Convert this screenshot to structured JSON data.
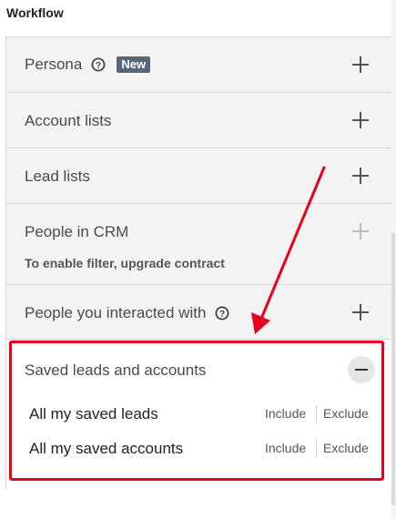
{
  "header": {
    "title": "Workflow"
  },
  "filters": [
    {
      "label": "Persona",
      "has_help": true,
      "badge": "New",
      "action_icon": "plus-icon"
    },
    {
      "label": "Account lists",
      "action_icon": "plus-icon"
    },
    {
      "label": "Lead lists",
      "action_icon": "plus-icon"
    },
    {
      "label": "People in CRM",
      "action_icon": "plus-icon",
      "disabled": true,
      "note": "To enable filter, upgrade contract"
    },
    {
      "label": "People you interacted with",
      "has_help": true,
      "action_icon": "plus-icon"
    }
  ],
  "saved": {
    "label": "Saved leads and accounts",
    "action_icon": "minus-icon",
    "options": [
      {
        "label": "All my saved leads",
        "include": "Include",
        "exclude": "Exclude"
      },
      {
        "label": "All my saved accounts",
        "include": "Include",
        "exclude": "Exclude"
      }
    ]
  },
  "annotation": {
    "color": "#e8001f"
  },
  "colors": {
    "badge": "#56687a",
    "row_bg": "#f3f3f3"
  }
}
